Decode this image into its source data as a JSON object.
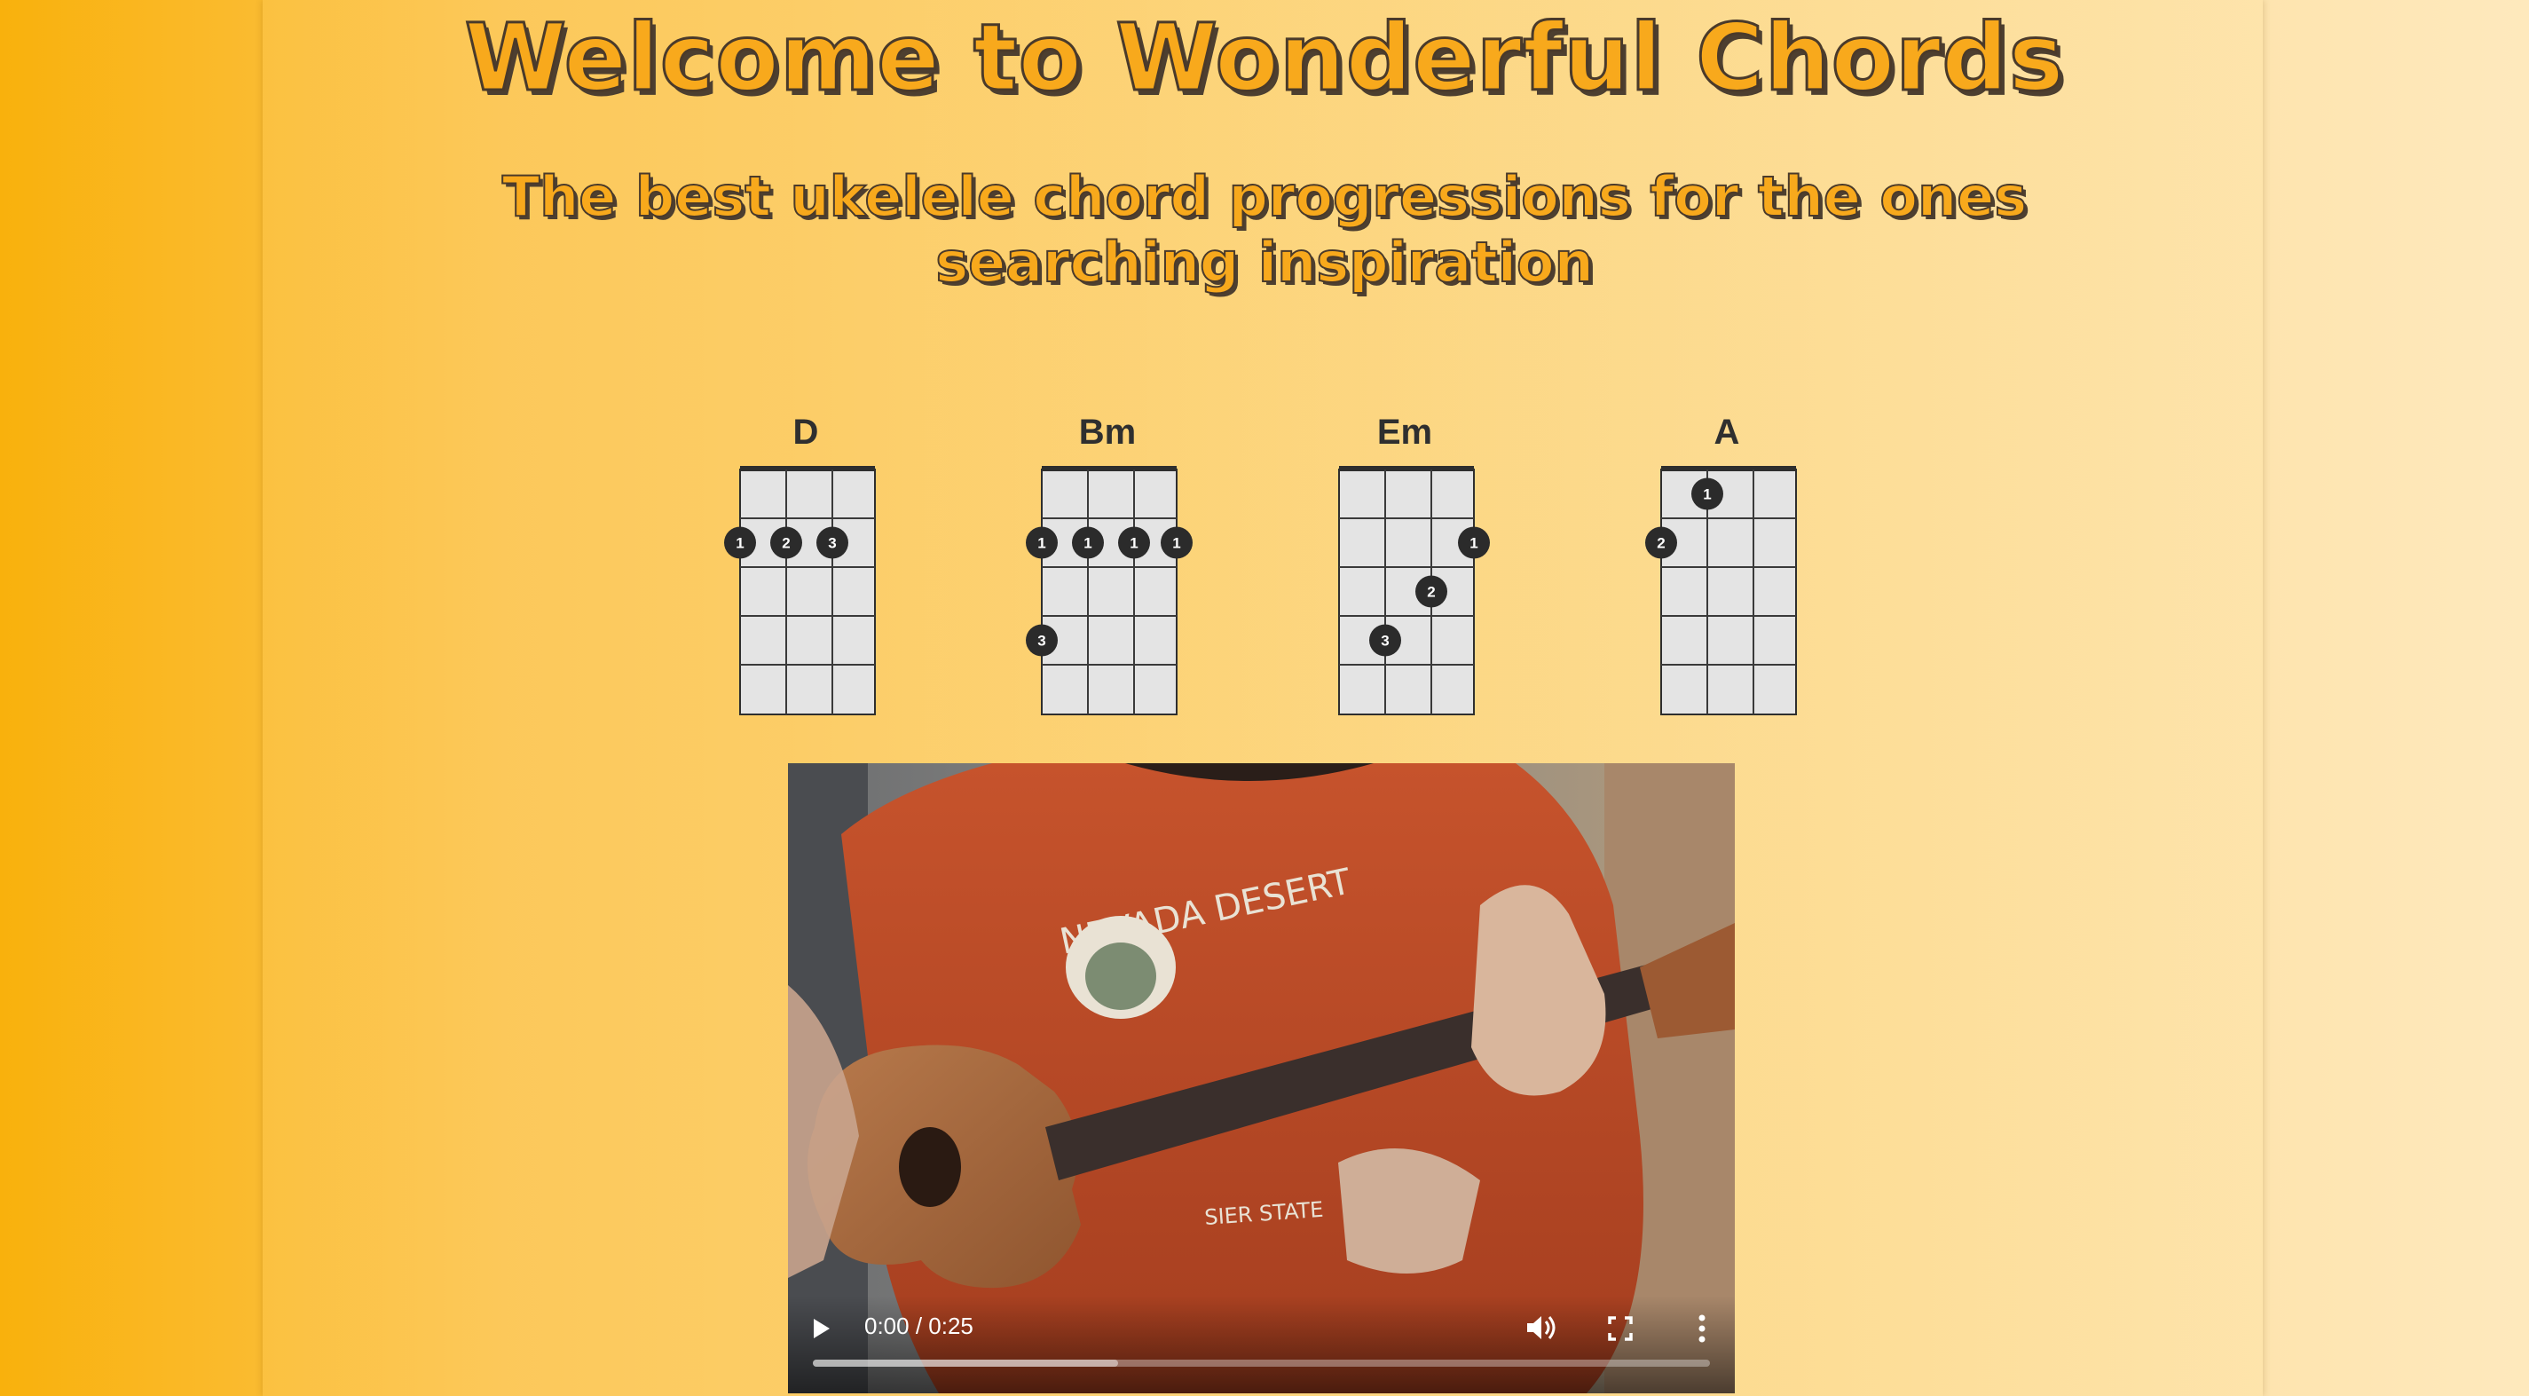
{
  "header": {
    "title": "Welcome to Wonderful Chords",
    "subtitle": "The best ukelele chord progressions for the ones searching inspiration"
  },
  "chords": [
    {
      "name": "D",
      "dots": [
        {
          "string": 0,
          "fret": 2,
          "finger": "1"
        },
        {
          "string": 1,
          "fret": 2,
          "finger": "2"
        },
        {
          "string": 2,
          "fret": 2,
          "finger": "3"
        }
      ]
    },
    {
      "name": "Bm",
      "dots": [
        {
          "string": 0,
          "fret": 2,
          "finger": "1"
        },
        {
          "string": 1,
          "fret": 2,
          "finger": "1"
        },
        {
          "string": 2,
          "fret": 2,
          "finger": "1"
        },
        {
          "string": 3,
          "fret": 2,
          "finger": "1"
        },
        {
          "string": 0,
          "fret": 4,
          "finger": "3"
        }
      ]
    },
    {
      "name": "Em",
      "dots": [
        {
          "string": 3,
          "fret": 2,
          "finger": "1"
        },
        {
          "string": 2,
          "fret": 3,
          "finger": "2"
        },
        {
          "string": 1,
          "fret": 4,
          "finger": "3"
        }
      ]
    },
    {
      "name": "A",
      "dots": [
        {
          "string": 1,
          "fret": 1,
          "finger": "1"
        },
        {
          "string": 0,
          "fret": 2,
          "finger": "2"
        }
      ]
    }
  ],
  "video": {
    "time": "0:00 / 0:25",
    "shirt_text": "NEVADA DESERT",
    "shirt_text_bottom": "SIER STATE",
    "progress_buffered": 0.34
  },
  "colors": {
    "accent": "#f8a91c",
    "title_outline": "#4a3a2a",
    "dot": "#2b2b2b",
    "fretboard": "#e4e4e4"
  },
  "icons": {
    "play": "play-icon",
    "volume": "volume-icon",
    "fullscreen": "fullscreen-icon",
    "more": "more-vert-icon"
  }
}
